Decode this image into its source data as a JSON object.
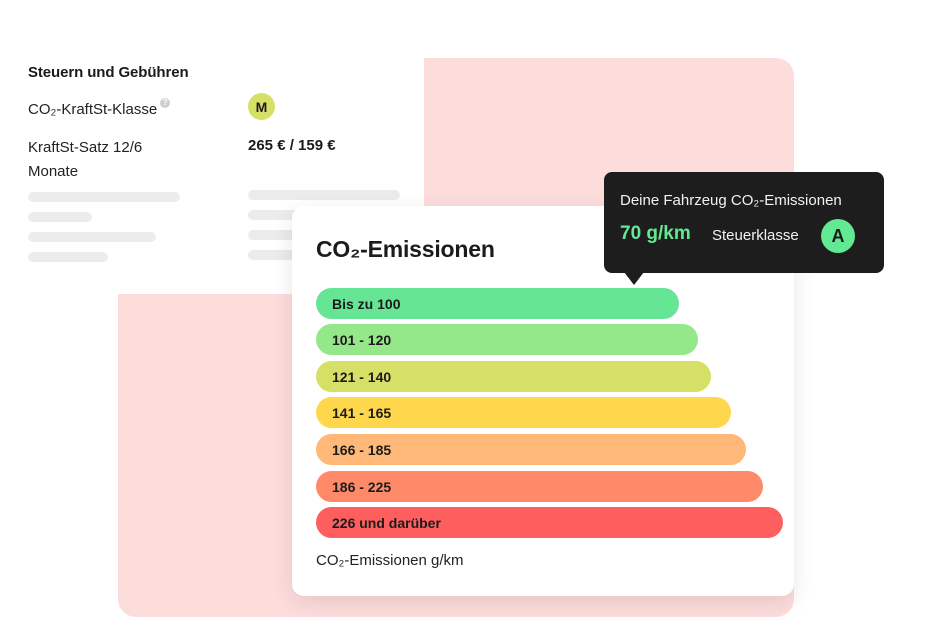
{
  "taxes": {
    "title": "Steuern und Gebühren",
    "co2_class_label": "CO₂-KraftSt-Klasse",
    "help_icon": "?",
    "co2_class_value": "M",
    "rate_label": "KraftSt-Satz 12/6 Monate",
    "rate_value": "265 € / 159 €"
  },
  "emissions": {
    "title": "CO₂-Emissionen",
    "footer": "CO₂-Emissionen g/km",
    "bars": [
      {
        "label": "Bis zu 100",
        "color": "#66e694"
      },
      {
        "label": "101 - 120",
        "color": "#94e88a"
      },
      {
        "label": "121 - 140",
        "color": "#d6e067"
      },
      {
        "label": "141 - 165",
        "color": "#fed74d"
      },
      {
        "label": "166 - 185",
        "color": "#ffb878"
      },
      {
        "label": "186 - 225",
        "color": "#ff8a6a"
      },
      {
        "label": "226 und darüber",
        "color": "#ff5e5e"
      }
    ]
  },
  "tooltip": {
    "title": "Deine Fahrzeug CO₂-Emissionen",
    "value": "70 g/km",
    "class_label": "Steuerklasse",
    "class_value": "A"
  },
  "colors": {
    "background_accent": "#fddcdc",
    "class_a": "#63e893",
    "class_m": "#d6e067",
    "tooltip_bg": "#1d1d1d"
  }
}
